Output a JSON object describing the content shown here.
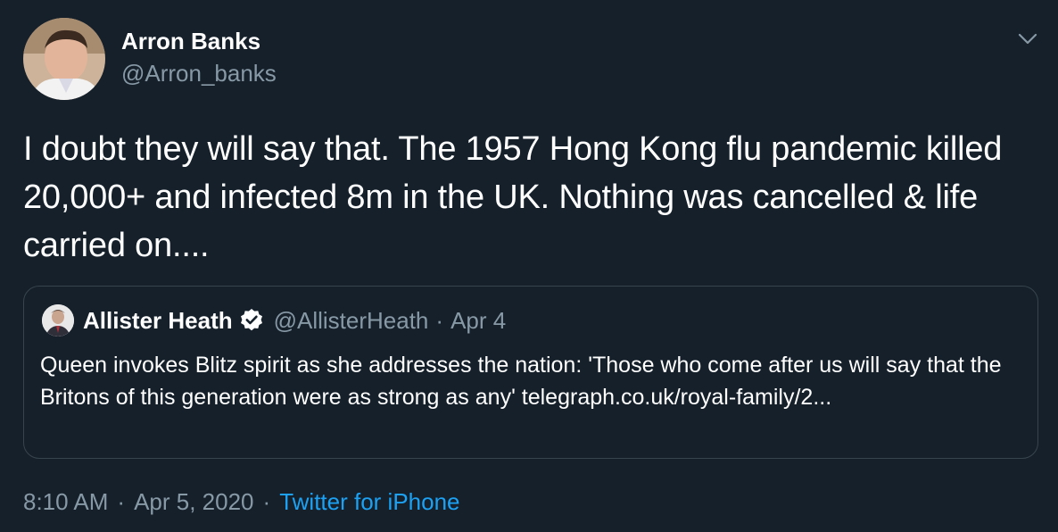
{
  "author": {
    "name": "Arron Banks",
    "handle": "@Arron_banks"
  },
  "tweet_text": "I doubt they will say that. The 1957 Hong Kong flu pandemic killed 20,000+ and infected 8m in the UK. Nothing was cancelled & life carried on....",
  "quoted_tweet": {
    "name": "Allister Heath",
    "handle": "@AllisterHeath",
    "separator": "·",
    "date": "Apr 4",
    "text": "Queen invokes Blitz spirit as she addresses the nation: 'Those who come after us will say that the Britons of this generation were as strong as any' telegraph.co.uk/royal-family/2..."
  },
  "meta": {
    "time": "8:10 AM",
    "separator1": "·",
    "date": "Apr 5, 2020",
    "separator2": "·",
    "source": "Twitter for iPhone"
  },
  "icons": {
    "caret": "chevron-down-icon",
    "verified": "verified-badge-icon"
  },
  "colors": {
    "background": "#15202b",
    "border": "#38444d",
    "secondary_text": "#8899a6",
    "accent": "#1da1f2"
  }
}
